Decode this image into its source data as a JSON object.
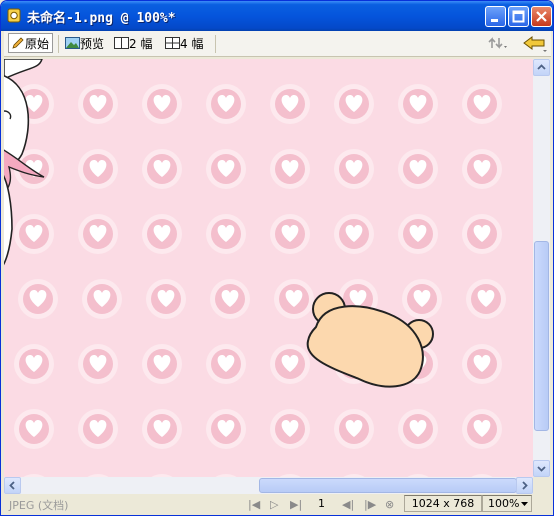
{
  "window": {
    "title": "未命名-1.png @ 100%*",
    "title_buttons": [
      "minimize-icon",
      "maximize-icon",
      "close-icon"
    ]
  },
  "toolbar": {
    "tabs": [
      {
        "label": "原始",
        "icon": "pencil-icon",
        "active": true
      },
      {
        "label": "预览",
        "icon": "image-preview-icon",
        "active": false
      },
      {
        "label": "2 幅",
        "icon": "two-panel-icon",
        "active": false
      },
      {
        "label": "4 幅",
        "icon": "four-panel-icon",
        "active": false
      }
    ],
    "right_icons": [
      "export-arrows-icon",
      "pointer-hand-icon"
    ]
  },
  "canvas": {
    "background_color": "#fbdbe4",
    "pattern": "heart-circle-icon",
    "accent_color": "#f4bfcd"
  },
  "status": {
    "file_type": "JPEG (文档)",
    "page": "1",
    "dimensions": "1024 x 768",
    "zoom": "100%"
  }
}
